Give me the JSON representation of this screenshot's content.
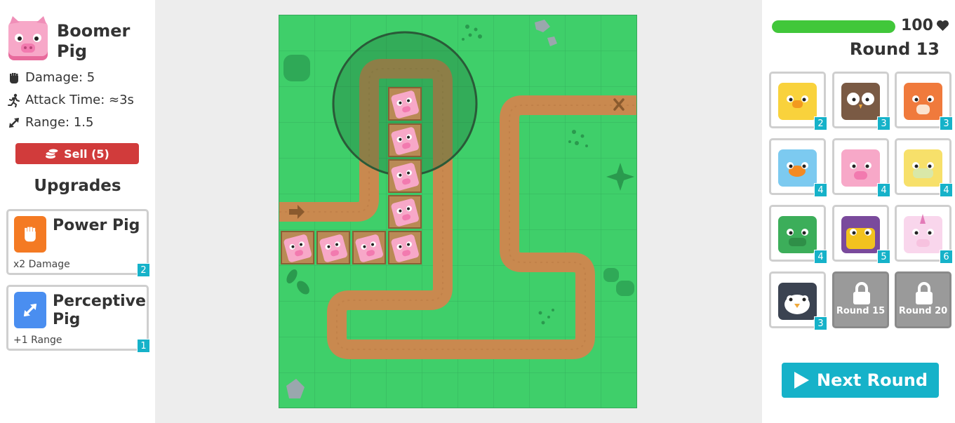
{
  "selected_tower": {
    "name": "Boomer Pig",
    "avatar": "pig-face-icon",
    "stats": [
      {
        "icon": "fist-icon",
        "text": "Damage: 5"
      },
      {
        "icon": "running-icon",
        "text": "Attack Time: ≈3s"
      },
      {
        "icon": "range-arrows-icon",
        "text": "Range: 1.5"
      }
    ],
    "sell_label": "Sell (5)",
    "upgrades_title": "Upgrades",
    "upgrades": [
      {
        "name": "Power Pig",
        "desc": "x2 Damage",
        "cost": "2",
        "icon": "fist-icon",
        "color": "#f47a23"
      },
      {
        "name": "Perceptive Pig",
        "desc": "+1 Range",
        "cost": "1",
        "icon": "range-arrows-icon",
        "color": "#4a8ef0"
      }
    ]
  },
  "status": {
    "health": "100",
    "health_fraction": 1.0,
    "round_label": "Round 13"
  },
  "shop": [
    {
      "animal": "chick",
      "cost": "2"
    },
    {
      "animal": "owl",
      "cost": "3"
    },
    {
      "animal": "squirrel",
      "cost": "3"
    },
    {
      "animal": "goldfish-bowl",
      "cost": "4"
    },
    {
      "animal": "pig",
      "cost": "4"
    },
    {
      "animal": "lion",
      "cost": "4"
    },
    {
      "animal": "dragon",
      "cost": "4"
    },
    {
      "animal": "witch-cat",
      "cost": "5"
    },
    {
      "animal": "unicorn",
      "cost": "6"
    },
    {
      "animal": "penguin",
      "cost": "3"
    },
    {
      "animal": "locked",
      "unlock": "Round 15"
    },
    {
      "animal": "locked",
      "unlock": "Round 20"
    }
  ],
  "next_round_label": "Next Round",
  "colors": {
    "grass": "#3fcf6a",
    "path": "#c9894f",
    "accent": "#16b2c9",
    "sell": "#d13b3b",
    "health": "#41c73a"
  }
}
